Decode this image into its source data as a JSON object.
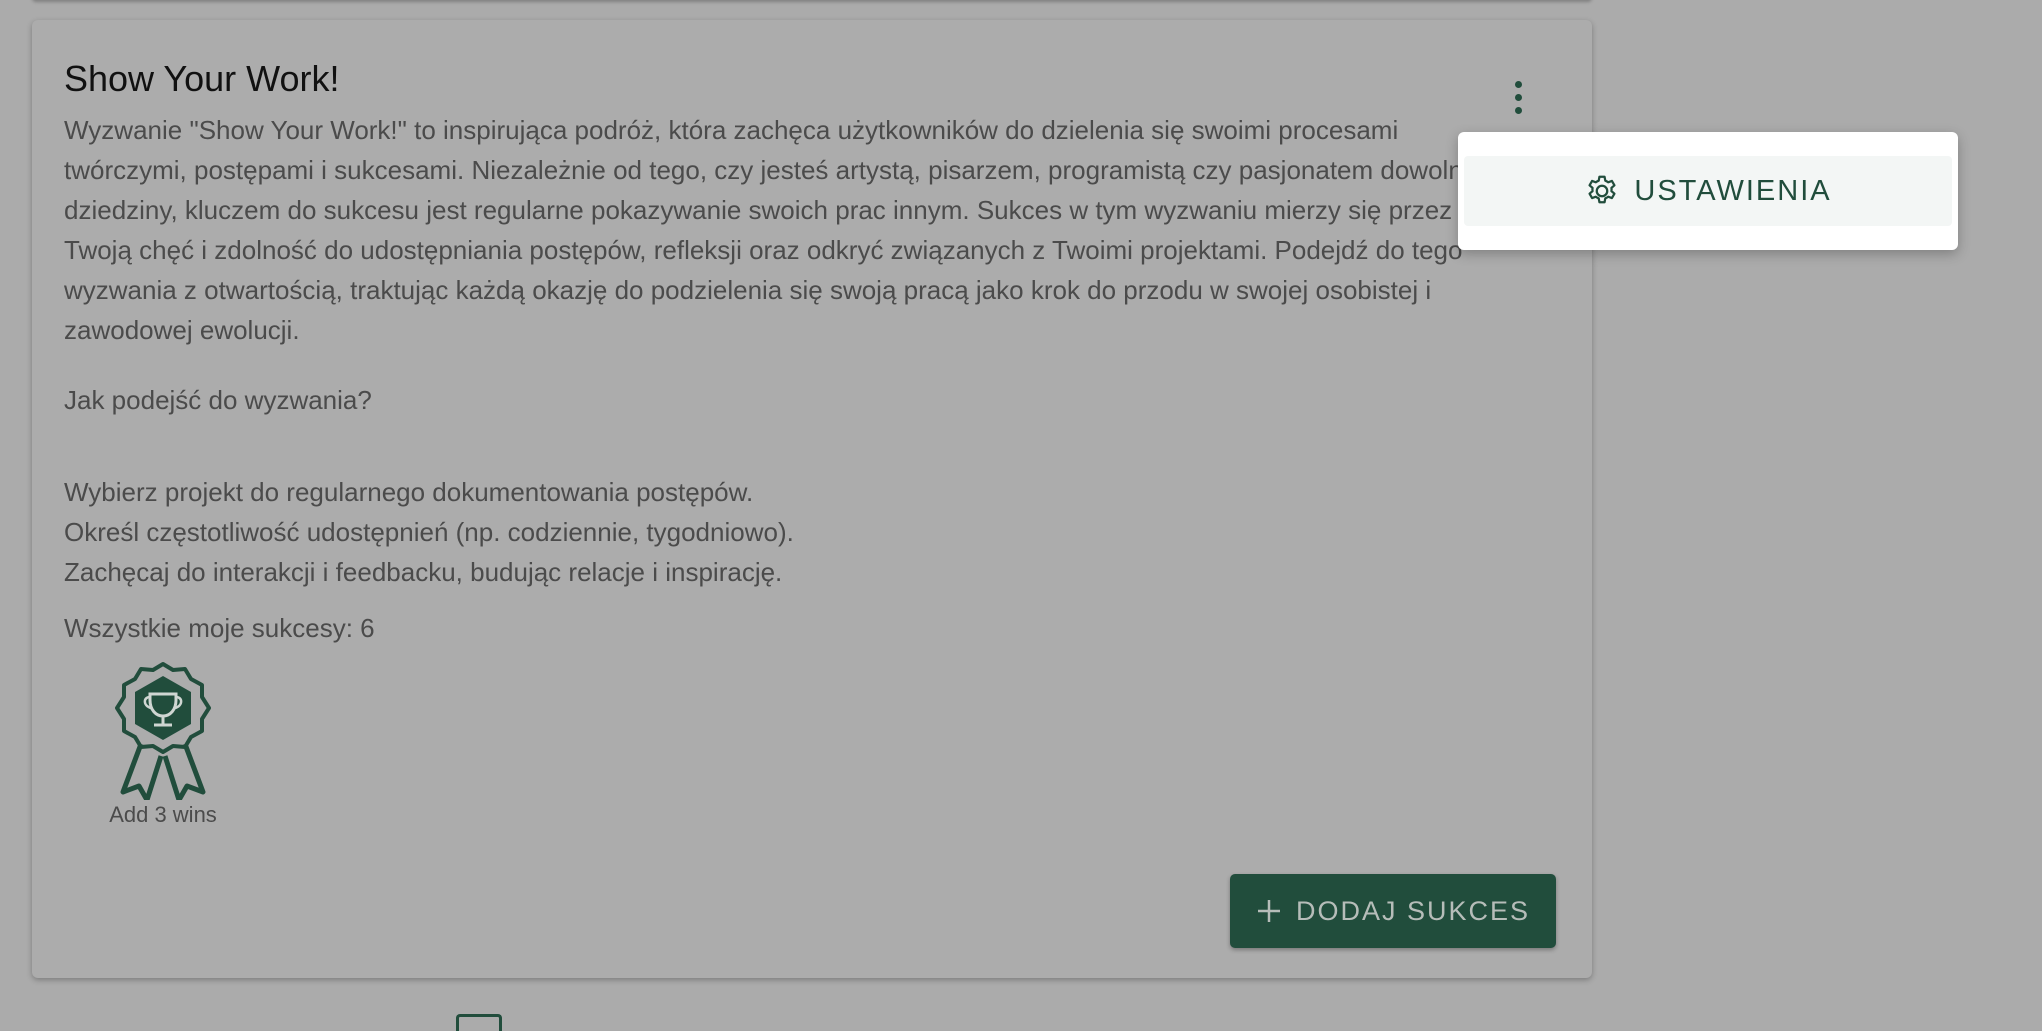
{
  "card": {
    "title": "Show Your Work!",
    "description": "Wyzwanie \"Show Your Work!\" to inspirująca podróż, która zachęca użytkowników do dzielenia się swoimi procesami twórczymi, postępami i sukcesami. Niezależnie od tego, czy jesteś artystą, pisarzem, programistą czy pasjonatem dowolnej dziedziny, kluczem do sukcesu jest regularne pokazywanie swoich prac innym. Sukces w tym wyzwaniu mierzy się przez Twoją chęć i zdolność do udostępniania postępów, refleksji oraz odkryć związanych z Twoimi projektami. Podejdź do tego wyzwania z otwartością, traktując każdą okazję do podzielenia się swoją pracą jako krok do przodu w swojej osobistej i zawodowej ewolucji.",
    "question": "Jak podejść do wyzwania?",
    "steps": [
      "Wybierz projekt do regularnego dokumentowania postępów.",
      "Określ częstotliwość udostępnień (np. codziennie, tygodniowo).",
      "Zachęcaj do interakcji i feedbacku, budując relacje i inspirację."
    ],
    "wins_count": "Wszystkie moje sukcesy: 6",
    "badge_label": "Add 3 wins",
    "badge_icon": "trophy-rosette-icon",
    "add_button_label": "DODAJ SUKCES",
    "add_button_icon": "plus-icon",
    "menu_icon": "kebab-menu-icon"
  },
  "menu": {
    "settings_label": "USTAWIENIA",
    "settings_icon": "gear-icon"
  },
  "colors": {
    "accent": "#214d3c",
    "overlay_background": "#ababab",
    "menu_background": "#ffffff",
    "menu_item_background": "#f3f6f5"
  }
}
